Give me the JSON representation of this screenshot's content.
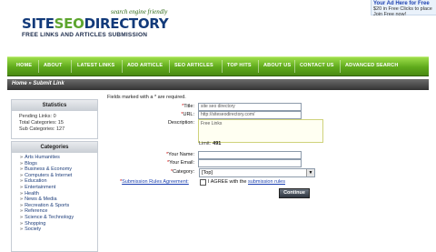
{
  "header": {
    "tagline": "search engine friendly",
    "logo_part1": "SITE",
    "logo_part2": "SEO",
    "logo_part3": "DIRECTORY",
    "logo_sub": "FREE LINKS AND ARTICLES SUBMISSION",
    "ad_title": "Your Ad Here for Free",
    "ad_line1": "$20 in Free Clicks to place",
    "ad_line2": "Join Free now!"
  },
  "nav": [
    "HOME",
    "ABOUT",
    "LATEST LINKS",
    "ADD ARTICLE",
    "SEO ARTICLES",
    "TOP HITS",
    "ABOUT US",
    "CONTACT US",
    "ADVANCED SEARCH"
  ],
  "breadcrumb": "Home » Submit Link",
  "stats": {
    "title": "Statistics",
    "pending": "Pending Links: 0",
    "total": "Total Categories: 15",
    "sub": "Sub Categories: 127"
  },
  "categories": {
    "title": "Categories",
    "items": [
      "Arts Humanities",
      "Blogs",
      "Business & Economy",
      "Computers & Internet",
      "Education",
      "Entertainment",
      "Health",
      "News & Media",
      "Recreation & Sports",
      "Reference",
      "Science & Technology",
      "Shopping",
      "Society"
    ]
  },
  "form": {
    "required_note": "Fields marked with a * are required.",
    "title_label": "Title:",
    "title_value": "site seo directory",
    "url_label": "URL:",
    "url_value": "http://siteseodirectory.com/",
    "desc_label": "Description:",
    "desc_value": "Free Links",
    "limit_label": "Limit:",
    "limit_value": "491",
    "name_label": "Your Name:",
    "email_label": "Your Email:",
    "category_label": "Category:",
    "category_value": "[Top]",
    "agreement_label": "Submission Rules Agreement:",
    "agree_text": "I AGREE with the",
    "agree_link": "submission rules",
    "submit_label": "Continue"
  }
}
